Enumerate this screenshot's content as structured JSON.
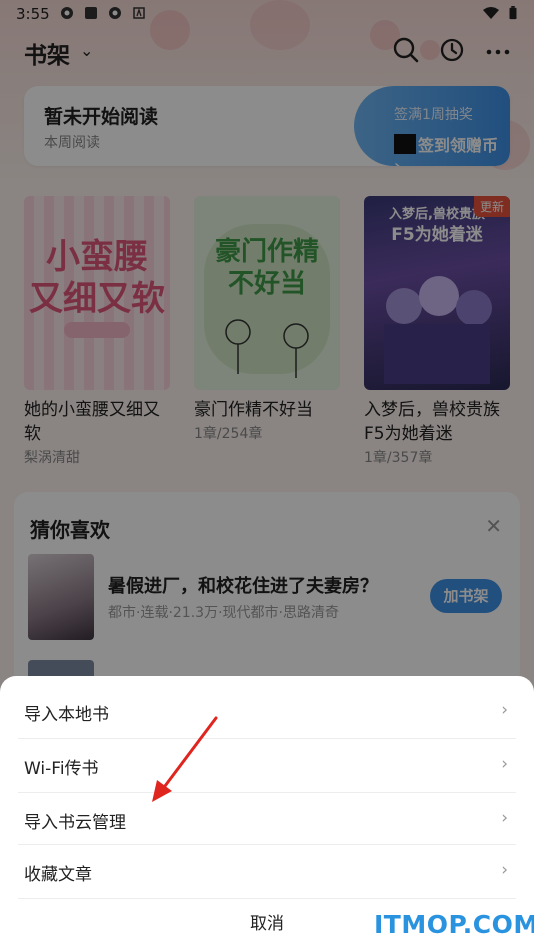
{
  "status_bar": {
    "time": "3:55"
  },
  "header": {
    "title": "书架"
  },
  "reading_card": {
    "title": "暂未开始阅读",
    "subtitle": "本周阅读",
    "signin_top": "签满1周抽奖",
    "signin_bottom": "签到领赠币"
  },
  "books": [
    {
      "title": "她的小蛮腰又细又软",
      "sub": "梨涡清甜",
      "cover_text": "小蛮腰\n又细又软"
    },
    {
      "title": "豪门作精不好当",
      "sub": "1章/254章",
      "cover_text": "豪门作精\n不好当"
    },
    {
      "title": "入梦后，兽校贵族F5为她着迷",
      "sub": "1章/357章",
      "cover_text": "入梦后,兽校贵族\nF5为她着迷",
      "badge": "更新"
    }
  ],
  "guess": {
    "title": "猜你喜欢",
    "item": {
      "title": "暑假进厂，和校花住进了夫妻房？",
      "meta": "都市·连载·21.3万·现代都市·思路清奇",
      "button": "加书架"
    }
  },
  "sheet": {
    "options": [
      "导入本地书",
      "Wi-Fi传书",
      "导入书云管理",
      "收藏文章"
    ],
    "cancel": "取消"
  },
  "watermark": "ITMOP.COM",
  "colors": {
    "accent": "#3d90e6",
    "annotation_arrow": "#e0251f"
  }
}
